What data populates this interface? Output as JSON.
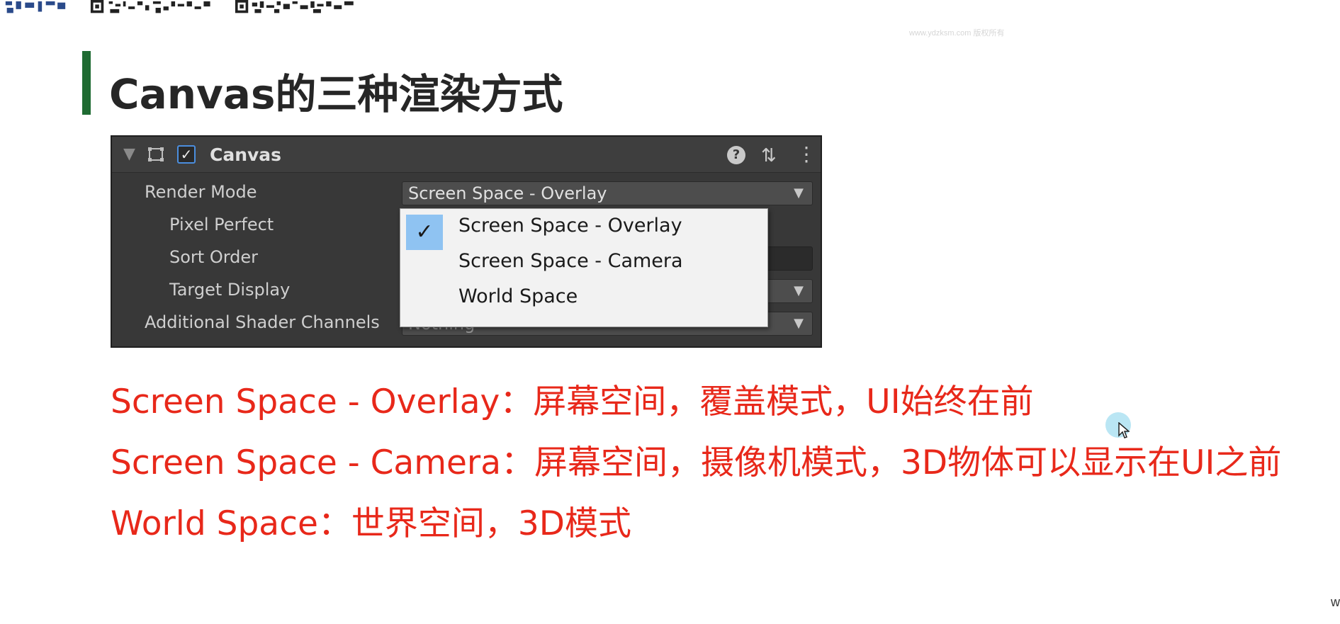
{
  "slide": {
    "title": "Canvas的三种渲染方式",
    "watermark": "www.ydzksm.com 版权所有",
    "corner_text": "w"
  },
  "inspector": {
    "component_name": "Canvas",
    "enabled_check": "✓",
    "help_glyph": "?",
    "presets_glyph": "⇅",
    "more_glyph": "⋮",
    "foldout_glyph": "▼",
    "rows": [
      {
        "label": "Render Mode",
        "value": "Screen Space - Overlay"
      },
      {
        "label": "Pixel Perfect",
        "value": ""
      },
      {
        "label": "Sort Order",
        "value": ""
      },
      {
        "label": "Target Display",
        "value": ""
      },
      {
        "label": "Additional Shader Channels",
        "value": "Nothing"
      }
    ],
    "dropdown_arrow": "▼"
  },
  "popup_menu": {
    "items": [
      {
        "label": "Screen Space - Overlay",
        "checked": true
      },
      {
        "label": "Screen Space - Camera",
        "checked": false
      },
      {
        "label": "World Space",
        "checked": false
      }
    ],
    "check_glyph": "✓"
  },
  "explanations": [
    "Screen Space - Overlay：屏幕空间，覆盖模式，UI始终在前",
    "Screen Space - Camera：屏幕空间，摄像机模式，3D物体可以显示在UI之前",
    "World Space：世界空间，3D模式"
  ],
  "colors": {
    "title_bar": "#1f6b32",
    "explanation_text": "#e8281a",
    "inspector_bg": "#383838",
    "popup_selected": "#8fc3f2"
  },
  "icons": {
    "rect_transform": "rect-transform-icon",
    "help": "help-icon",
    "presets": "presets-icon",
    "more": "kebab-menu-icon",
    "checkmark": "checkmark-icon",
    "cursor": "mouse-cursor-icon"
  }
}
